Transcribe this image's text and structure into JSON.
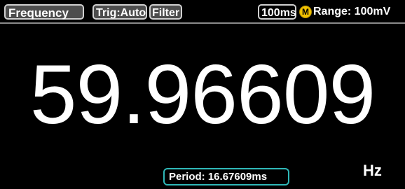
{
  "status_bar": {
    "mode": "Frequency",
    "trigger": "Trig:Auto",
    "filter": "Filter",
    "rate": "100ms",
    "manual_indicator": "M",
    "range": "Range: 100mV"
  },
  "reading": {
    "value": "59.96609",
    "unit": "Hz"
  },
  "secondary": {
    "period": "Period:  16.67609ms"
  },
  "colors": {
    "background": "#000000",
    "chip_fill": "#4d4d4d",
    "chip_border": "#d0d0d0",
    "manual_icon": "#f2c200",
    "period_border": "#2fb8b8",
    "text": "#ffffff"
  },
  "icons": {
    "manual_range": "manual-range-icon"
  }
}
